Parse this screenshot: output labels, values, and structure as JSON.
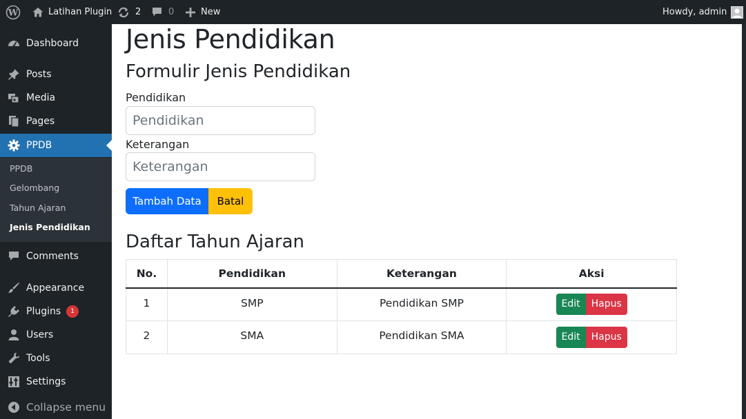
{
  "adminbar": {
    "wp_logo_icon": "wordpress-icon",
    "site_name": "Latihan Plugin",
    "updates_count": "2",
    "comments_count": "0",
    "new_label": "New",
    "howdy": "Howdy, admin"
  },
  "sidebar": {
    "items": [
      {
        "label": "Dashboard",
        "icon": "dashboard-icon"
      },
      {
        "label": "Posts",
        "icon": "pin-icon"
      },
      {
        "label": "Media",
        "icon": "media-icon"
      },
      {
        "label": "Pages",
        "icon": "pages-icon"
      },
      {
        "label": "PPDB",
        "icon": "gear-icon"
      },
      {
        "label": "Comments",
        "icon": "comment-icon"
      },
      {
        "label": "Appearance",
        "icon": "brush-icon"
      },
      {
        "label": "Plugins",
        "icon": "plugin-icon",
        "badge": "1"
      },
      {
        "label": "Users",
        "icon": "user-icon"
      },
      {
        "label": "Tools",
        "icon": "wrench-icon"
      },
      {
        "label": "Settings",
        "icon": "settings-icon"
      }
    ],
    "submenu": [
      "PPDB",
      "Gelombang",
      "Tahun Ajaran",
      "Jenis Pendidikan"
    ],
    "collapse_label": "Collapse menu"
  },
  "main": {
    "page_title": "Jenis Pendidikan",
    "form_title": "Formulir Jenis Pendidikan",
    "fields": {
      "pendidikan": {
        "label": "Pendidikan",
        "placeholder": "Pendidikan",
        "value": ""
      },
      "keterangan": {
        "label": "Keterangan",
        "placeholder": "Keterangan",
        "value": ""
      }
    },
    "buttons": {
      "submit": "Tambah Data",
      "cancel": "Batal"
    },
    "list_title": "Daftar Tahun Ajaran",
    "table": {
      "headers": [
        "No.",
        "Pendidikan",
        "Keterangan",
        "Aksi"
      ],
      "rows": [
        {
          "no": "1",
          "pendidikan": "SMP",
          "keterangan": "Pendidikan SMP",
          "edit": "Edit",
          "delete": "Hapus"
        },
        {
          "no": "2",
          "pendidikan": "SMA",
          "keterangan": "Pendidikan SMA",
          "edit": "Edit",
          "delete": "Hapus"
        }
      ]
    }
  },
  "colors": {
    "primary": "#0d6efd",
    "warning": "#ffc107",
    "success": "#198754",
    "danger": "#dc3545",
    "wp_accent": "#2271b1",
    "wp_dark": "#1d2327"
  }
}
